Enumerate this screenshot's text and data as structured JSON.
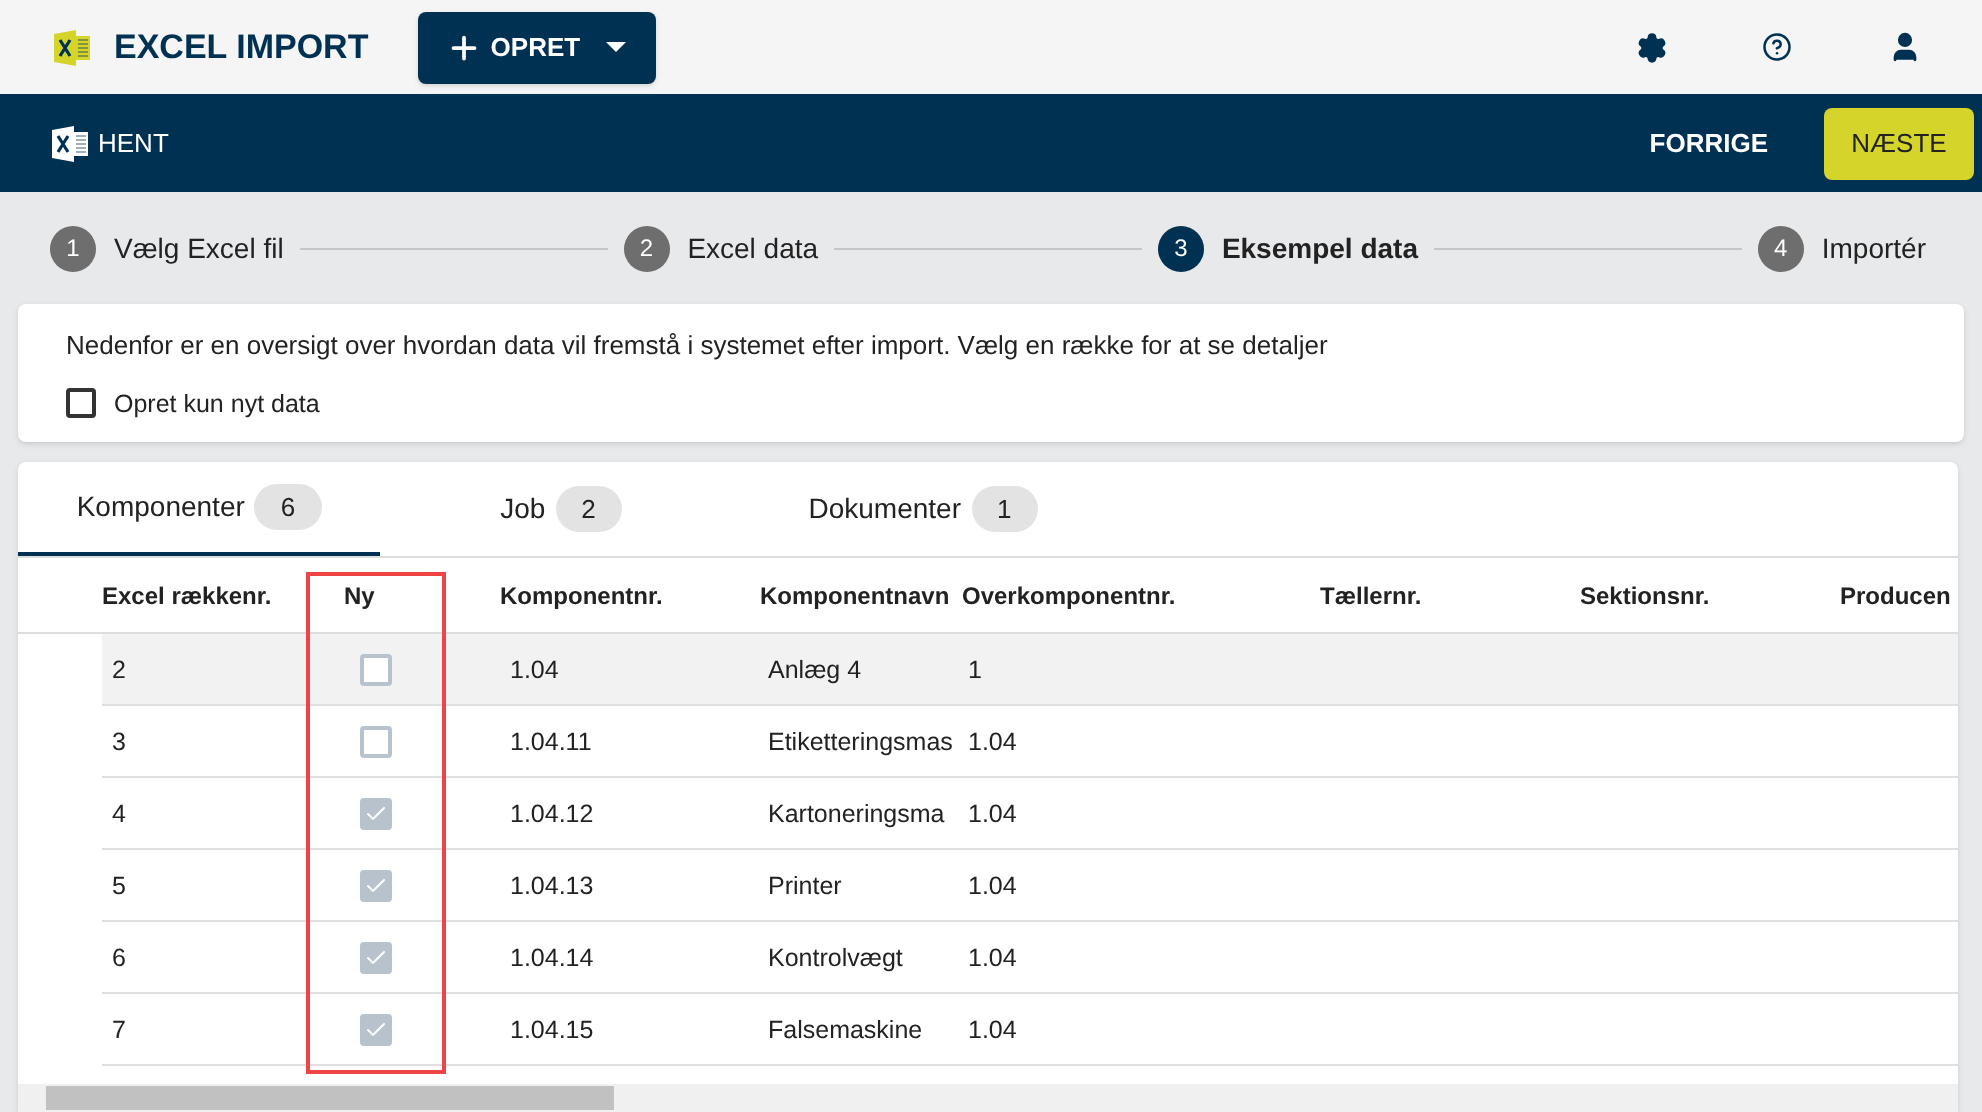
{
  "app": {
    "title": "EXCEL IMPORT",
    "create_button": "OPRET"
  },
  "toolbar": {
    "fetch": "HENT",
    "previous": "FORRIGE",
    "next": "NÆSTE"
  },
  "steps": [
    {
      "number": "1",
      "label": "Vælg Excel fil",
      "selected": false
    },
    {
      "number": "2",
      "label": "Excel data",
      "selected": false
    },
    {
      "number": "3",
      "label": "Eksempel data",
      "selected": true
    },
    {
      "number": "4",
      "label": "Importér",
      "selected": false
    }
  ],
  "info": {
    "text": "Nedenfor er en oversigt over hvordan data vil fremstå i systemet efter import. Vælg en række for at se detaljer",
    "only_new": {
      "label": "Opret kun nyt data",
      "checked": false
    }
  },
  "tabs": [
    {
      "label": "Komponenter",
      "count": "6",
      "selected": true
    },
    {
      "label": "Job",
      "count": "2",
      "selected": false
    },
    {
      "label": "Dokumenter",
      "count": "1",
      "selected": false
    }
  ],
  "table": {
    "columns": [
      "Excel rækkenr.",
      "Ny",
      "Komponentnr.",
      "Komponentnavn",
      "Overkomponentnr.",
      "Tællernr.",
      "Sektionsnr.",
      "Producen"
    ],
    "new_column_highlighted": true,
    "rows": [
      {
        "row": "2",
        "new": false,
        "number": "1.04",
        "name": "Anlæg 4",
        "parent": "1",
        "selected": true
      },
      {
        "row": "3",
        "new": false,
        "number": "1.04.11",
        "name": "Etiketteringsmas",
        "parent": "1.04",
        "selected": false
      },
      {
        "row": "4",
        "new": true,
        "number": "1.04.12",
        "name": "Kartoneringsma",
        "parent": "1.04",
        "selected": false
      },
      {
        "row": "5",
        "new": true,
        "number": "1.04.13",
        "name": "Printer",
        "parent": "1.04",
        "selected": false
      },
      {
        "row": "6",
        "new": true,
        "number": "1.04.14",
        "name": "Kontrolvægt",
        "parent": "1.04",
        "selected": false
      },
      {
        "row": "7",
        "new": true,
        "number": "1.04.15",
        "name": "Falsemaskine",
        "parent": "1.04",
        "selected": false
      }
    ]
  }
}
